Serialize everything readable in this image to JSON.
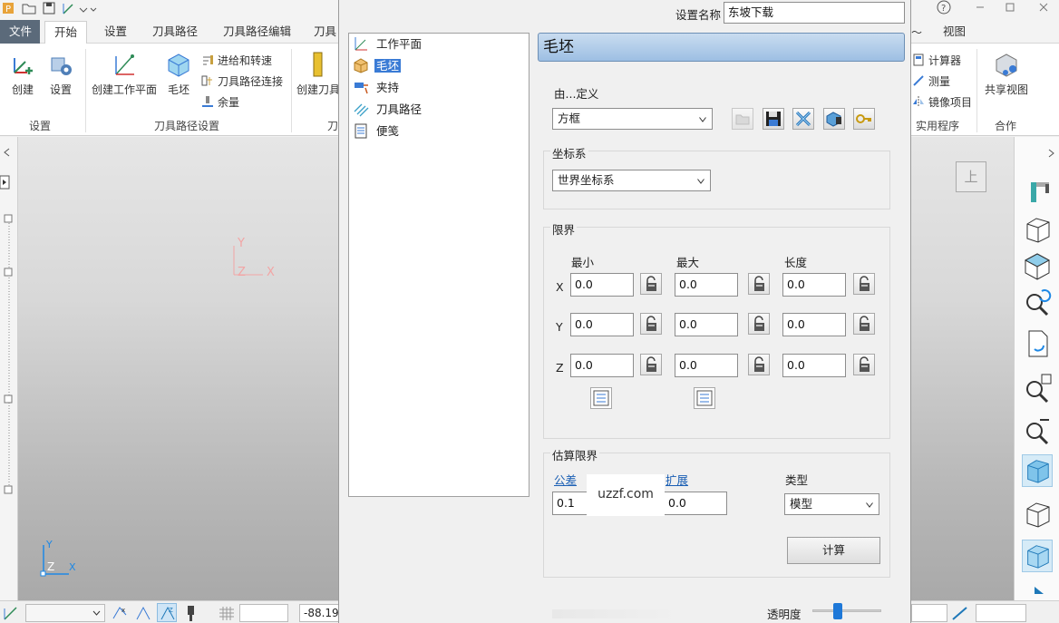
{
  "ribbon": {
    "tabs": [
      "文件",
      "开始",
      "设置",
      "刀具路径",
      "刀具路径编辑",
      "刀具"
    ],
    "right_tabs": [
      "视图"
    ],
    "buttons": {
      "create": "创建",
      "settings": "设置",
      "create_workplane": "创建工作平面",
      "stock": "毛坯",
      "feed_speed": "进给和转速",
      "toolpath_connect": "刀具路径连接",
      "allowance": "余量",
      "create_tool": "创建刀具",
      "calculator": "计算器",
      "measure": "测量",
      "mirror_item": "镜像项目",
      "share_view": "共享视图"
    },
    "groups": [
      "设置",
      "刀具路径设置",
      "刀",
      "实用程序",
      "合作"
    ]
  },
  "viewport": {
    "view_cube_label": "上",
    "axes": {
      "y": "Y",
      "z": "Z",
      "x": "X"
    }
  },
  "statusbar": {
    "coord": "-88.19"
  },
  "dialog": {
    "setting_name_label": "设置名称",
    "setting_name_value": "东坡下载",
    "header_title": "毛坯",
    "tree": [
      "工作平面",
      "毛坯",
      "夹持",
      "刀具路径",
      "便笺"
    ],
    "tree_selected": 1,
    "defined_by_label": "由...定义",
    "defined_by_value": "方框",
    "coord_label": "坐标系",
    "coord_value": "世界坐标系",
    "limits_label": "限界",
    "col_headers": [
      "最小",
      "最大",
      "长度"
    ],
    "rows": [
      {
        "axis": "X",
        "min": "0.0",
        "max": "0.0",
        "len": "0.0"
      },
      {
        "axis": "Y",
        "min": "0.0",
        "max": "0.0",
        "len": "0.0"
      },
      {
        "axis": "Z",
        "min": "0.0",
        "max": "0.0",
        "len": "0.0"
      }
    ],
    "estimate_label": "估算限界",
    "tolerance_label": "公差",
    "tolerance_value": "0.1",
    "expand_label": "扩展",
    "expand_value": "0.0",
    "type_label": "类型",
    "type_value": "模型",
    "calculate_label": "计算",
    "transparency_label": "透明度",
    "transparency_level": 0.35
  },
  "watermark": "uzzf.com",
  "colors": {
    "header_bg": "#a9c7e8",
    "selection": "#3a7bd5",
    "link": "#1a5fb4",
    "file_tab": "#5b6a7a"
  }
}
